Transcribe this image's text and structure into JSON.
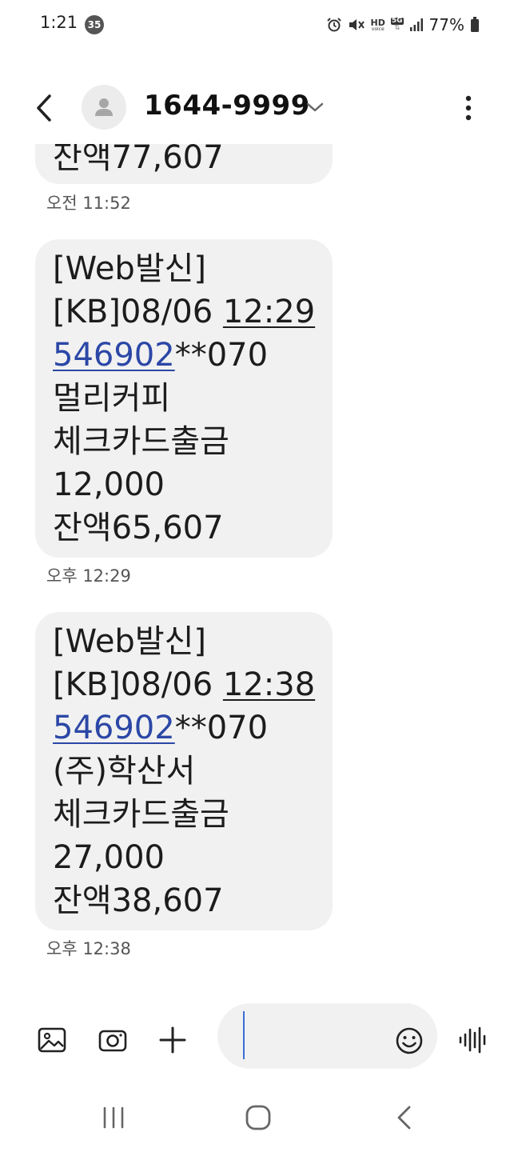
{
  "status_bar": {
    "time": "1:21",
    "notification_count": "35",
    "hd_label": "HD",
    "voice_label": "voice",
    "network_label": "5G",
    "battery_percent": "77%",
    "icons": [
      "alarm-icon",
      "mute-icon",
      "hd-voice-icon",
      "5g-icon",
      "signal-icon",
      "battery-icon"
    ]
  },
  "header": {
    "contact_name": "1644-9999",
    "icons": [
      "back-icon",
      "avatar-icon",
      "chevron-down-icon",
      "more-vert-icon"
    ]
  },
  "messages": [
    {
      "lines": [
        {
          "parts": [
            {
              "text": "잔액77,607"
            }
          ]
        }
      ],
      "time": "오전 11:52"
    },
    {
      "lines": [
        {
          "parts": [
            {
              "text": "[Web발신]"
            }
          ]
        },
        {
          "parts": [
            {
              "text": "[KB]08/06 "
            },
            {
              "text": "12:29",
              "style": "ul"
            }
          ]
        },
        {
          "parts": [
            {
              "text": "546902",
              "style": "link"
            },
            {
              "text": "**070"
            }
          ]
        },
        {
          "parts": [
            {
              "text": "멀리커피"
            }
          ]
        },
        {
          "parts": [
            {
              "text": "체크카드출금"
            }
          ]
        },
        {
          "parts": [
            {
              "text": "12,000"
            }
          ]
        },
        {
          "parts": [
            {
              "text": "잔액65,607"
            }
          ]
        }
      ],
      "time": "오후 12:29"
    },
    {
      "lines": [
        {
          "parts": [
            {
              "text": "[Web발신]"
            }
          ]
        },
        {
          "parts": [
            {
              "text": "[KB]08/06 "
            },
            {
              "text": "12:38",
              "style": "ul"
            }
          ]
        },
        {
          "parts": [
            {
              "text": "546902",
              "style": "link"
            },
            {
              "text": "**070"
            }
          ]
        },
        {
          "parts": [
            {
              "text": "(주)학산서"
            }
          ]
        },
        {
          "parts": [
            {
              "text": "체크카드출금"
            }
          ]
        },
        {
          "parts": [
            {
              "text": "27,000"
            }
          ]
        },
        {
          "parts": [
            {
              "text": "잔액38,607"
            }
          ]
        }
      ],
      "time": "오후 12:38"
    }
  ],
  "composer": {
    "input_value": "",
    "icons": [
      "gallery-icon",
      "camera-icon",
      "plus-icon",
      "emoji-icon",
      "voice-wave-icon"
    ]
  },
  "nav_bar": {
    "icons": [
      "recents-icon",
      "home-icon",
      "back-icon"
    ]
  },
  "colors": {
    "bubble": "#f1f1f1",
    "link": "#2b47a6",
    "caret": "#3b6fd6",
    "text": "#1c1c1c",
    "timestamp": "#555555"
  }
}
